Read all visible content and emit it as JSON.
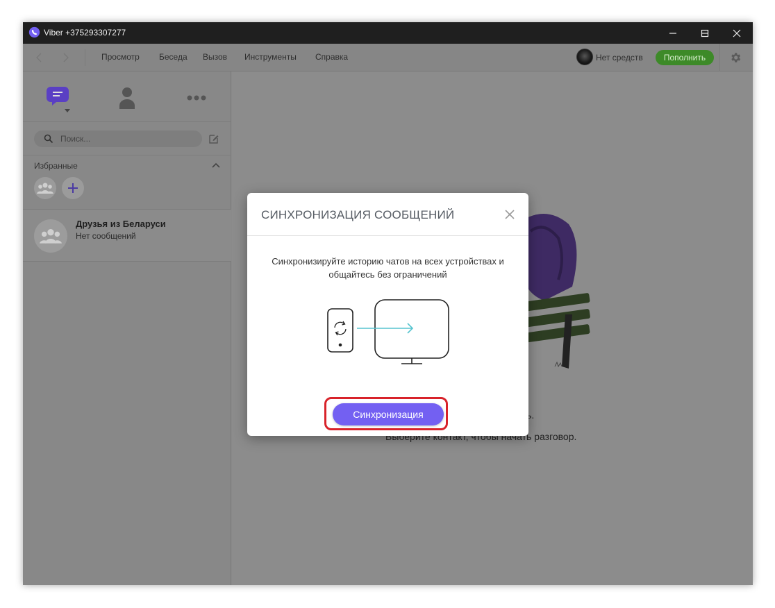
{
  "window": {
    "title": "Viber +375293307277"
  },
  "menu": {
    "items": [
      {
        "label": "Просмотр"
      },
      {
        "label": "Беседа"
      },
      {
        "label": "Вызов"
      },
      {
        "label": "Инструменты"
      },
      {
        "label": "Справка"
      }
    ],
    "balance_text": "Нет средств",
    "topup_label": "Пополнить"
  },
  "sidebar": {
    "tabs": [
      "chats-icon",
      "contacts-icon",
      "more-icon"
    ],
    "search_placeholder": "Поиск...",
    "favorites_label": "Избранные",
    "chats": [
      {
        "name": "Друзья из Беларуси",
        "subtitle": "Нет сообщений"
      }
    ]
  },
  "main": {
    "empty_line1": "здесь.",
    "empty_line2": "Выберите контакт, чтобы начать разговор."
  },
  "modal": {
    "title": "СИНХРОНИЗАЦИЯ СООБЩЕНИЙ",
    "description": "Синхронизируйте историю чатов на всех устройствах и общайтесь без ограничений",
    "sync_button": "Синхронизация"
  },
  "colors": {
    "viber_purple": "#7360f2",
    "topup_green": "#3d8a28",
    "highlight_red": "#d8232a"
  }
}
